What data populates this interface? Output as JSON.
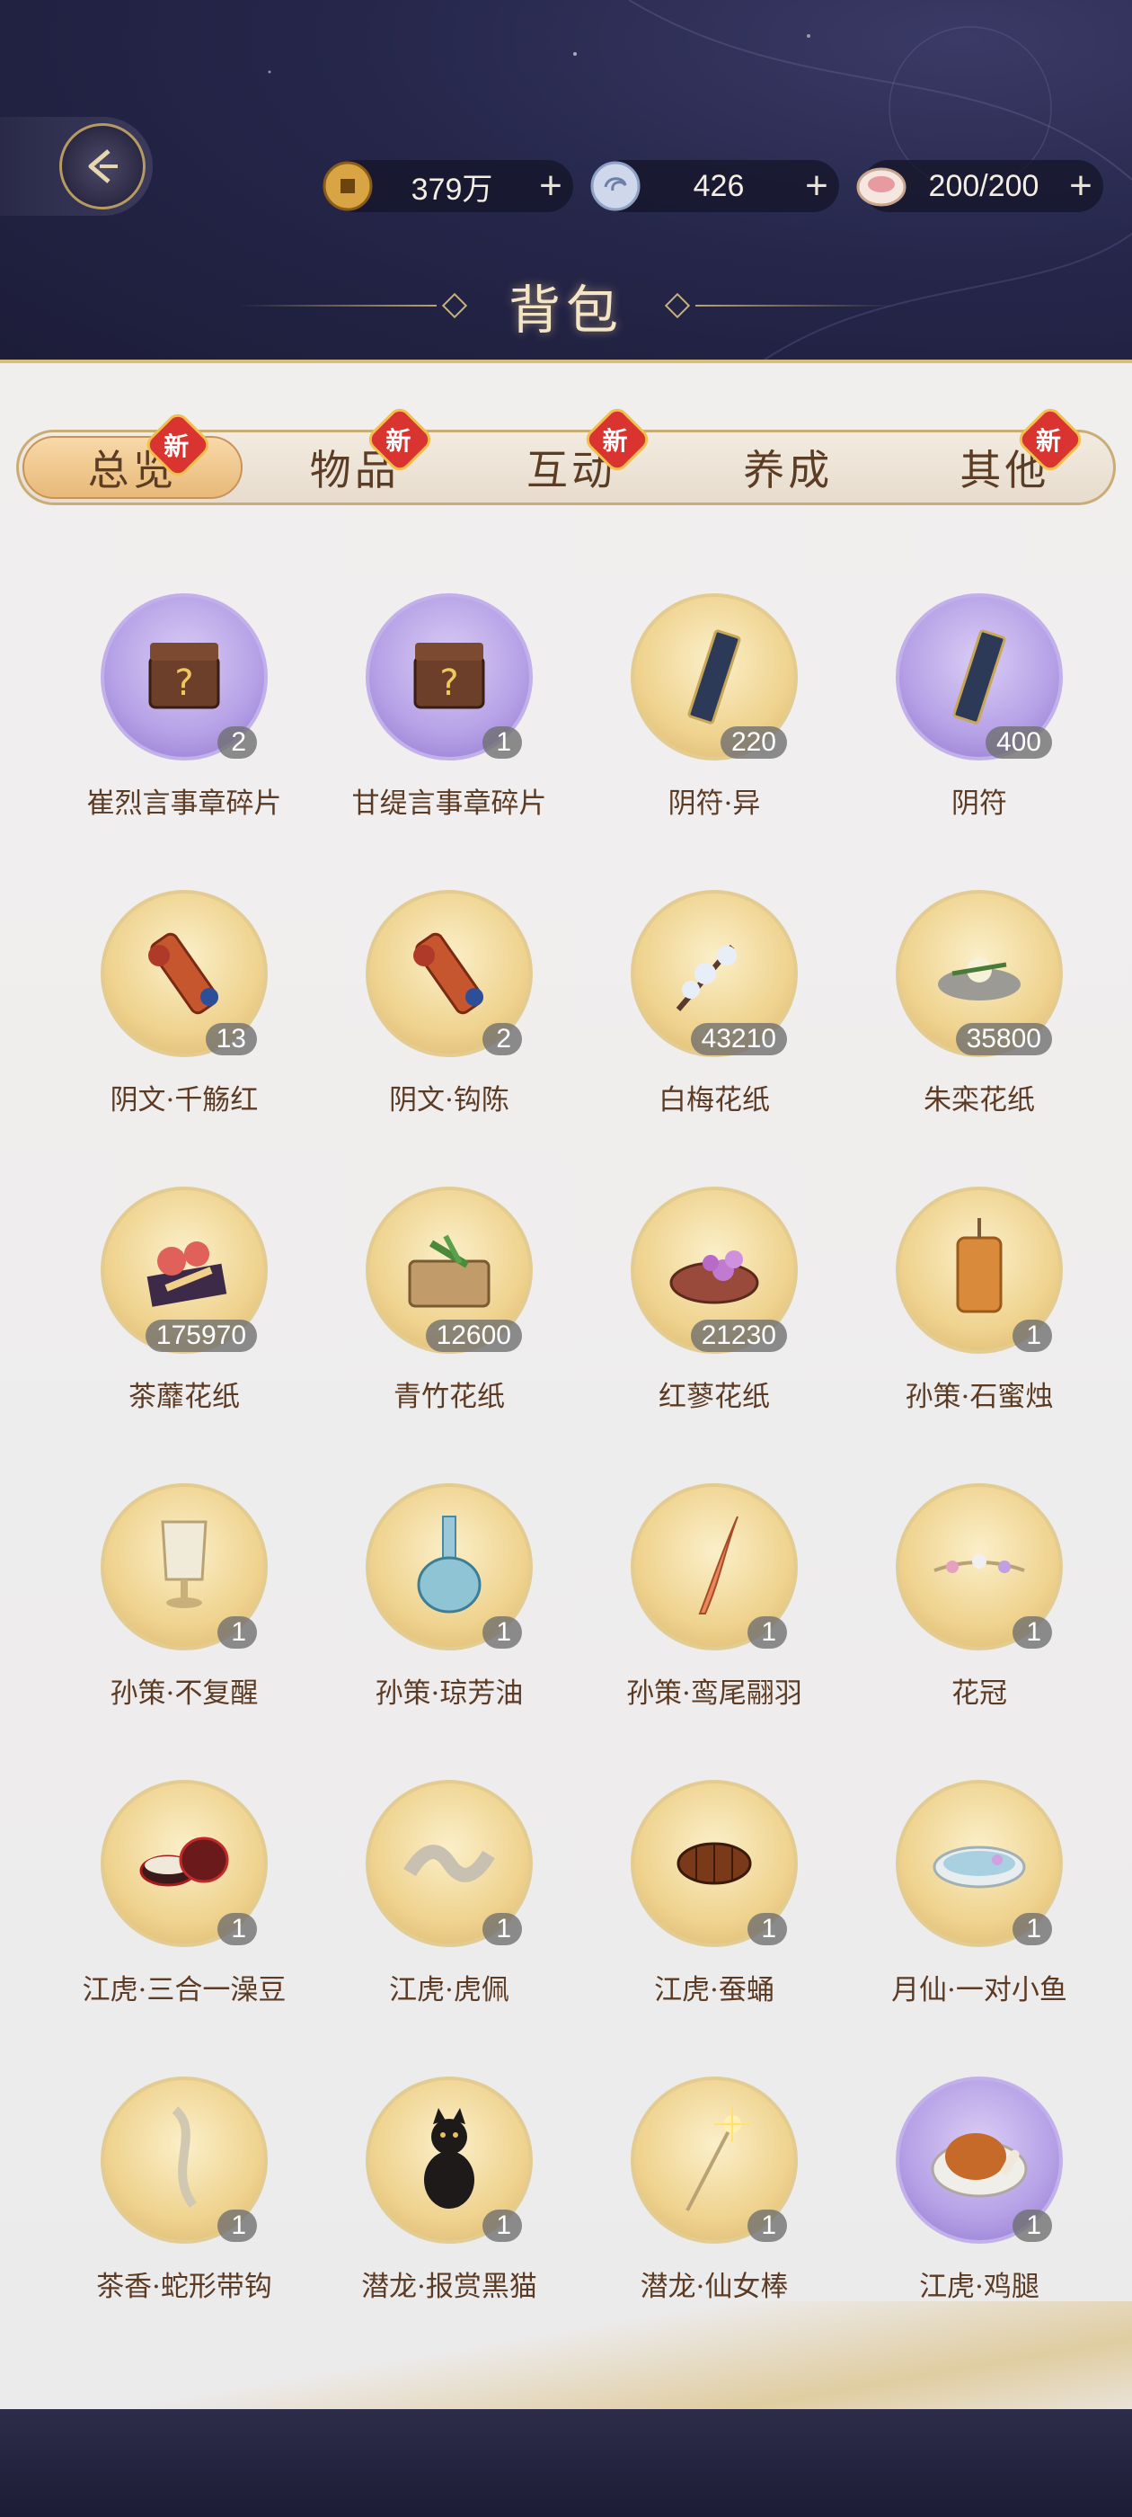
{
  "header": {
    "title": "背包",
    "resources": [
      {
        "icon": "coin-icon",
        "value": "379万"
      },
      {
        "icon": "jade-icon",
        "value": "426"
      },
      {
        "icon": "food-bowl-icon",
        "value": "200/200"
      }
    ]
  },
  "tabs": [
    {
      "label": "总览",
      "badge": "新",
      "active": true
    },
    {
      "label": "物品",
      "badge": "新",
      "active": false
    },
    {
      "label": "互动",
      "badge": "新",
      "active": false
    },
    {
      "label": "养成",
      "badge": "",
      "active": false
    },
    {
      "label": "其他",
      "badge": "新",
      "active": false
    }
  ],
  "items": [
    {
      "name": "崔烈言事章碎片",
      "count": "2",
      "bg": "purple",
      "icon": "chest-icon"
    },
    {
      "name": "甘缇言事章碎片",
      "count": "1",
      "bg": "purple",
      "icon": "chest-icon"
    },
    {
      "name": "阴符·异",
      "count": "220",
      "bg": "gold",
      "icon": "talisman-icon"
    },
    {
      "name": "阴符",
      "count": "400",
      "bg": "purple",
      "icon": "talisman-icon"
    },
    {
      "name": "阴文·千觞红",
      "count": "13",
      "bg": "gold",
      "icon": "scroll-icon"
    },
    {
      "name": "阴文·钩陈",
      "count": "2",
      "bg": "gold",
      "icon": "scroll-icon"
    },
    {
      "name": "白梅花纸",
      "count": "43210",
      "bg": "gold",
      "icon": "plum-blossom-icon"
    },
    {
      "name": "朱栾花纸",
      "count": "35800",
      "bg": "gold",
      "icon": "flower-icon"
    },
    {
      "name": "茶蘼花纸",
      "count": "175970",
      "bg": "gold",
      "icon": "flower-cloth-icon"
    },
    {
      "name": "青竹花纸",
      "count": "12600",
      "bg": "gold",
      "icon": "bamboo-icon"
    },
    {
      "name": "红蓼花纸",
      "count": "21230",
      "bg": "gold",
      "icon": "flower-plate-icon"
    },
    {
      "name": "孙策·石蜜烛",
      "count": "1",
      "bg": "gold",
      "icon": "candle-icon"
    },
    {
      "name": "孙策·不复醒",
      "count": "1",
      "bg": "gold",
      "icon": "cup-icon"
    },
    {
      "name": "孙策·琼芳油",
      "count": "1",
      "bg": "gold",
      "icon": "bottle-icon"
    },
    {
      "name": "孙策·鸾尾翮羽",
      "count": "1",
      "bg": "gold",
      "icon": "feather-icon"
    },
    {
      "name": "花冠",
      "count": "1",
      "bg": "gold",
      "icon": "flower-crown-icon"
    },
    {
      "name": "江虎·三合一澡豆",
      "count": "1",
      "bg": "gold",
      "icon": "box-icon"
    },
    {
      "name": "江虎·虎佩",
      "count": "1",
      "bg": "gold",
      "icon": "pendant-icon"
    },
    {
      "name": "江虎·蚕蛹",
      "count": "1",
      "bg": "gold",
      "icon": "cocoon-icon"
    },
    {
      "name": "月仙·一对小鱼",
      "count": "1",
      "bg": "gold",
      "icon": "fish-bowl-icon"
    },
    {
      "name": "茶香·蛇形带钩",
      "count": "1",
      "bg": "gold",
      "icon": "hook-icon"
    },
    {
      "name": "潜龙·报赏黑猫",
      "count": "1",
      "bg": "gold",
      "icon": "black-cat-icon"
    },
    {
      "name": "潜龙·仙女棒",
      "count": "1",
      "bg": "gold",
      "icon": "sparkler-icon"
    },
    {
      "name": "江虎·鸡腿",
      "count": "1",
      "bg": "purple",
      "icon": "chicken-leg-icon"
    }
  ],
  "colors": {
    "accent_gold": "#e8b979",
    "badge_red": "#d9342f",
    "text_brown": "#5c3b24"
  }
}
